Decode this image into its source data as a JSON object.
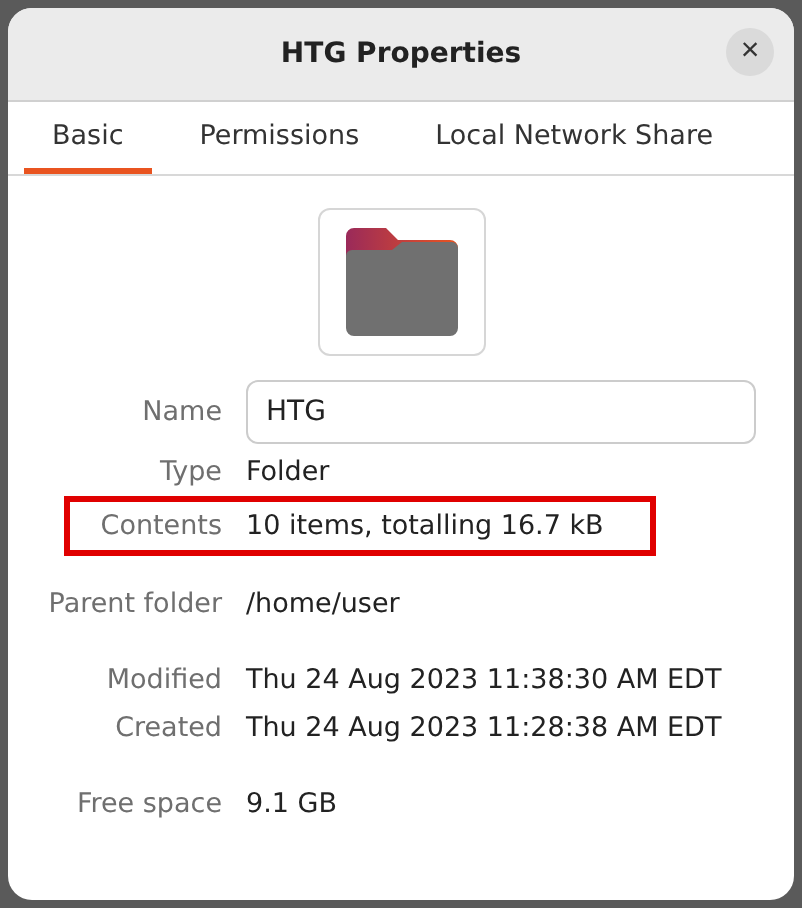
{
  "window": {
    "title": "HTG Properties",
    "close": "×"
  },
  "tabs": [
    {
      "label": "Basic",
      "selected": true
    },
    {
      "label": "Permissions",
      "selected": false
    },
    {
      "label": "Local Network Share",
      "selected": false
    }
  ],
  "name_field": {
    "label": "Name",
    "value": "HTG"
  },
  "groups": [
    {
      "rows": [
        {
          "label": "Type",
          "value": "Folder",
          "highlighted": false
        },
        {
          "label": "Contents",
          "value": "10 items, totalling 16.7 kB",
          "highlighted": true
        }
      ]
    },
    {
      "rows": [
        {
          "label": "Parent folder",
          "value": "/home/user",
          "highlighted": false
        }
      ]
    },
    {
      "rows": [
        {
          "label": "Modified",
          "value": "Thu 24 Aug 2023 11:38:30 AM EDT",
          "highlighted": false
        },
        {
          "label": "Created",
          "value": "Thu 24 Aug 2023 11:28:38 AM EDT",
          "highlighted": false
        }
      ]
    },
    {
      "rows": [
        {
          "label": "Free space",
          "value": "9.1 GB",
          "highlighted": false
        }
      ]
    }
  ]
}
